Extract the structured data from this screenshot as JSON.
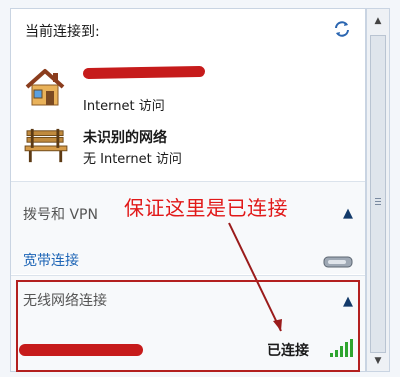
{
  "header": {
    "title": "当前连接到:"
  },
  "connections": [
    {
      "name_redacted": true,
      "status": "Internet 访问"
    },
    {
      "name": "未识别的网络",
      "status": "无 Internet 访问"
    }
  ],
  "sections": [
    {
      "title": "拨号和 VPN",
      "collapsed_icon": "chevron-up-icon",
      "items": [
        {
          "label": "宽带连接"
        }
      ]
    },
    {
      "title": "无线网络连接",
      "collapsed_icon": "chevron-up-icon",
      "items": [
        {
          "name_redacted": true,
          "status": "已连接",
          "signal_icon": "wifi-signal-icon"
        }
      ]
    }
  ],
  "annotation": {
    "text": "保证这里是已连接",
    "color": "#e11919"
  },
  "colors": {
    "accent_link": "#1d65b6",
    "annotation": "#e11919",
    "signal": "#2fa52f"
  }
}
